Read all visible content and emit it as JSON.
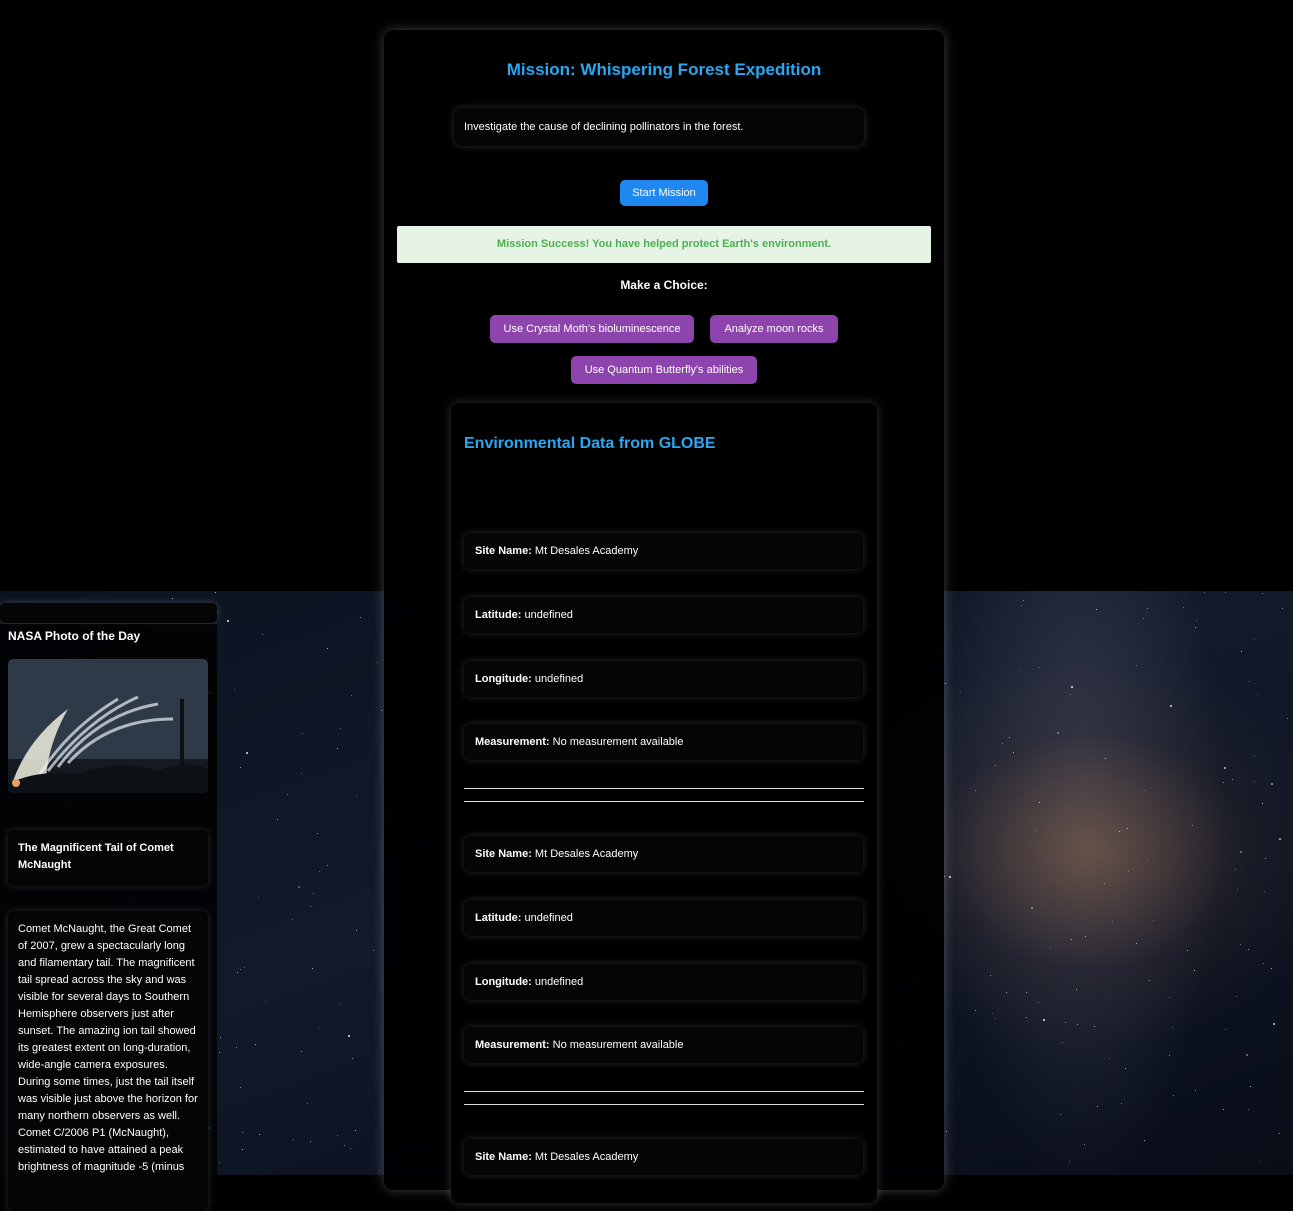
{
  "mission": {
    "title": "Mission: Whispering Forest Expedition",
    "description": "Investigate the cause of declining pollinators in the forest.",
    "start_label": "Start Mission",
    "success_message": "Mission Success! You have helped protect Earth's environment.",
    "choice_heading": "Make a Choice:",
    "choices": [
      "Use Crystal Moth's bioluminescence",
      "Analyze moon rocks",
      "Use Quantum Butterfly's abilities"
    ]
  },
  "environment": {
    "title": "Environmental Data from GLOBE",
    "labels": {
      "site": "Site Name:",
      "lat": "Latitude:",
      "lon": "Longitude:",
      "measurement": "Measurement:"
    },
    "records": [
      {
        "site": "Mt Desales Academy",
        "lat": "undefined",
        "lon": "undefined",
        "measurement": "No measurement available"
      },
      {
        "site": "Mt Desales Academy",
        "lat": "undefined",
        "lon": "undefined",
        "measurement": "No measurement available"
      },
      {
        "site": "Mt Desales Academy"
      }
    ]
  },
  "nasa": {
    "heading": "NASA Photo of the Day",
    "photo_title": "The Magnificent Tail of Comet McNaught",
    "explanation": "Comet McNaught, the Great Comet of 2007, grew a spectacularly long and filamentary tail. The magnificent tail spread across the sky and was visible for several days to Southern Hemisphere observers just after sunset. The amazing ion tail showed its greatest extent on long-duration, wide-angle camera exposures. During some times, just the tail itself was visible just above the horizon for many northern observers as well. Comet C/2006 P1 (McNaught), estimated to have attained a peak brightness of magnitude -5 (minus"
  },
  "colors": {
    "title_blue": "#2aa7f0",
    "start_button": "#1e88f0",
    "choice_button": "#8e44ad",
    "success_bg": "#e6f4e6",
    "success_text": "#4caf50"
  }
}
